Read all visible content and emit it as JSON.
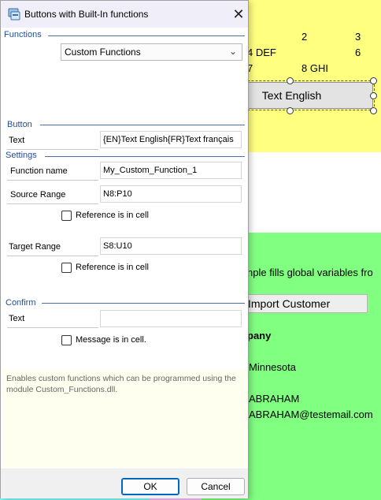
{
  "sheet": {
    "cells": {
      "num2": "2",
      "num3": "3",
      "def": "4  DEF",
      "num6": "6",
      "num7": "7",
      "ghi": "8  GHI",
      "desc": "nple fills global variables fro",
      "company": "pany",
      "state": "Minnesota",
      "name": "ABRAHAM",
      "email": "ABRAHAM@testemail.com"
    },
    "text_button_label": "Text English",
    "import_button_label": "Import Customer",
    "colors": {
      "yellow": "#ffff80",
      "green": "#80ff80",
      "cyan": "#80ffff",
      "pink": "#ffc0ff"
    }
  },
  "dialog": {
    "title": "Buttons with Built-In functions",
    "close_icon": "close-icon",
    "sections": {
      "functions": "Functions",
      "button": "Button",
      "settings": "Settings",
      "confirm": "Confirm"
    },
    "function_dropdown": {
      "selected": "Custom Functions",
      "icon": "chevron-down-icon"
    },
    "button_text": {
      "label": "Text",
      "value": "{EN}Text English{FR}Text français"
    },
    "function_name": {
      "label": "Function name",
      "value": "My_Custom_Function_1"
    },
    "source_range": {
      "label": "Source Range",
      "value": "N8:P10"
    },
    "source_ref_checkbox": {
      "label": "Reference is in cell",
      "checked": false
    },
    "target_range": {
      "label": "Target Range",
      "value": "S8:U10"
    },
    "target_ref_checkbox": {
      "label": "Reference is in cell",
      "checked": false
    },
    "confirm_text": {
      "label": "Text",
      "value": ""
    },
    "message_checkbox": {
      "label": "Message is in cell.",
      "checked": false
    },
    "info_text": "Enables custom functions which can be programmed using the module Custom_Functions.dll.",
    "ok_label": "OK",
    "cancel_label": "Cancel",
    "accent_color": "#1f4e9c"
  }
}
